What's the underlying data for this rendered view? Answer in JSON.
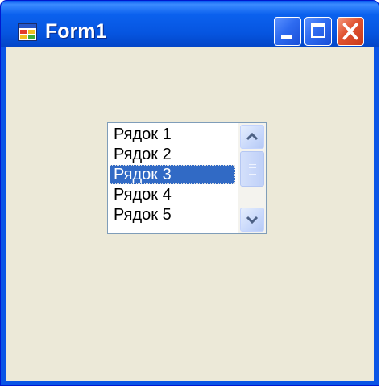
{
  "window": {
    "title": "Form1",
    "icons": {
      "app": "form-app-icon",
      "minimize": "minimize-icon",
      "maximize": "maximize-icon",
      "close": "close-icon"
    }
  },
  "listbox": {
    "items": [
      "Рядок 1",
      "Рядок 2",
      "Рядок 3",
      "Рядок 4",
      "Рядок 5"
    ],
    "selected_item": "Рядок 3",
    "scrollbar_icons": {
      "up": "chevron-up-icon",
      "down": "chevron-down-icon",
      "thumb": "scroll-thumb-grip-icon"
    }
  },
  "colors": {
    "titlebar": "#0a55e6",
    "client_background": "#ece9d8",
    "selection": "#316ac5",
    "close_button": "#e0522f"
  }
}
